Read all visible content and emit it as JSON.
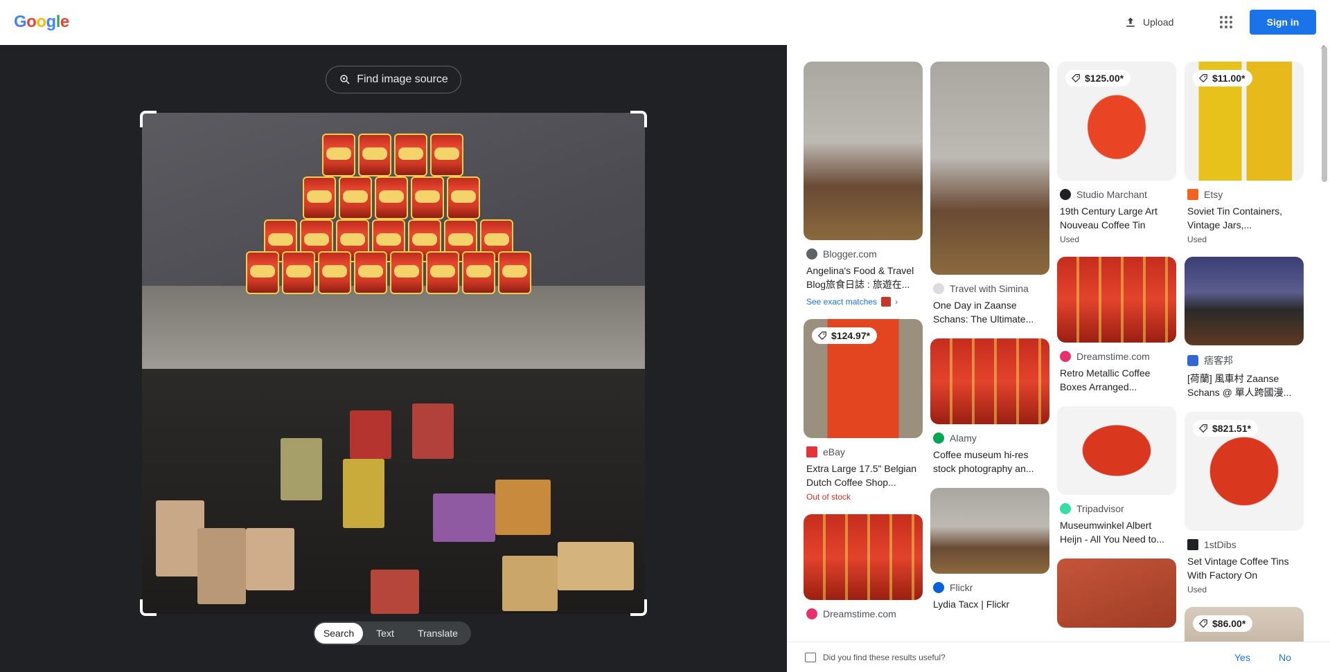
{
  "header": {
    "logo": "Google",
    "upload_label": "Upload",
    "signin_label": "Sign in"
  },
  "viewer": {
    "find_source_label": "Find image source",
    "modes": [
      "Search",
      "Text",
      "Translate"
    ],
    "active_mode": "Search"
  },
  "results": {
    "col1": [
      {
        "source": "Blogger.com",
        "title": "Angelina's Food & Travel Blog旅食日誌 : 旅遊在...",
        "exact": "See exact matches",
        "favicon_color": "#5f6368"
      },
      {
        "price": "$124.97*",
        "source": "eBay",
        "title": "Extra Large 17.5\" Belgian Dutch Coffee Shop...",
        "note": "Out of stock",
        "favicon_color": "#e53238"
      },
      {
        "source": "Dreamstime.com",
        "title": "",
        "favicon_color": "#e8306e"
      }
    ],
    "col2": [
      {
        "source": "Travel with Simina",
        "title": "One Day in Zaanse Schans: The Ultimate...",
        "favicon_color": "#dadce0"
      },
      {
        "source": "Alamy",
        "title": "Coffee museum hi-res stock photography an...",
        "favicon_color": "#00a651"
      },
      {
        "source": "Flickr",
        "title": "Lydia Tacx | Flickr",
        "favicon_color": "#0063dc"
      }
    ],
    "col3": [
      {
        "price": "$125.00*",
        "source": "Studio Marchant",
        "title": "19th Century Large Art Nouveau Coffee Tin",
        "note": "Used",
        "favicon_color": "#202124"
      },
      {
        "source": "Dreamstime.com",
        "title": "Retro Metallic Coffee Boxes Arranged...",
        "favicon_color": "#e8306e"
      },
      {
        "source": "Tripadvisor",
        "title": "Museumwinkel Albert Heijn - All You Need to...",
        "favicon_color": "#34e0a1"
      }
    ],
    "col4": [
      {
        "price": "$11.00*",
        "source": "Etsy",
        "title": "Soviet Tin Containers, Vintage Jars,...",
        "note": "Used",
        "favicon_color": "#f1641e"
      },
      {
        "source": "痞客邦",
        "title": "[荷蘭] 風車村 Zaanse Schans @ 單人跨國漫...",
        "favicon_color": "#3367d6"
      },
      {
        "price": "$821.51*",
        "source": "1stDibs",
        "title": "Set Vintage Coffee Tins With Factory On",
        "note": "Used",
        "favicon_color": "#202124"
      },
      {
        "price": "$86.00*"
      }
    ]
  },
  "feedback": {
    "question": "Did you find these results useful?",
    "yes": "Yes",
    "no": "No"
  },
  "colors": {
    "accent": "#1a73e8",
    "viewer_bg": "#202124"
  }
}
